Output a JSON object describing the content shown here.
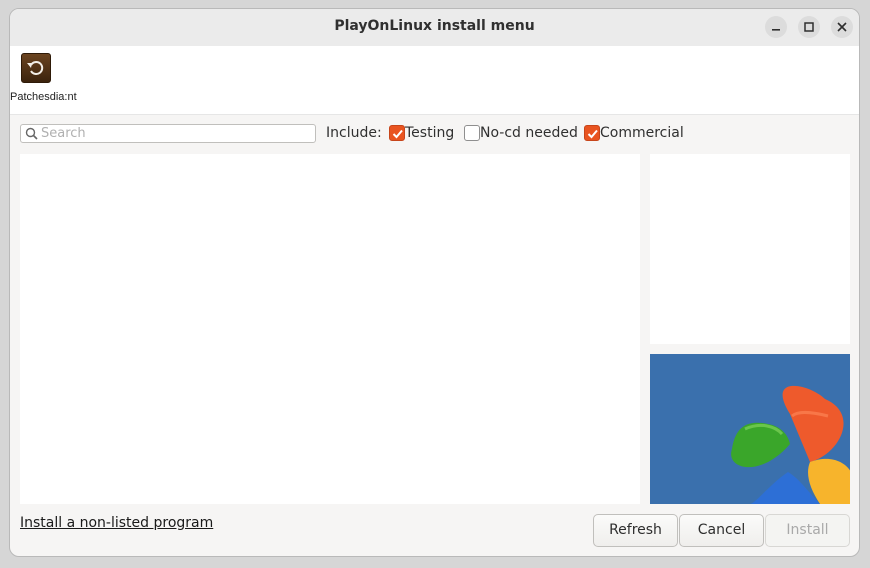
{
  "window": {
    "title": "PlayOnLinux install menu",
    "controls": [
      "minimize-icon",
      "maximize-icon",
      "close-icon"
    ]
  },
  "toolbar": {
    "items": [
      {
        "label": "Patchesdia:nt",
        "icon": "patches-icon"
      }
    ]
  },
  "filter": {
    "search_placeholder": "Search",
    "search_value": "",
    "include_label": "Include:",
    "options": [
      {
        "label": "Testing",
        "checked": true
      },
      {
        "label": "No-cd needed",
        "checked": false
      },
      {
        "label": "Commercial",
        "checked": true
      }
    ]
  },
  "footer": {
    "link_label": "Install a non-listed program",
    "buttons": {
      "refresh": "Refresh",
      "cancel": "Cancel",
      "install": "Install"
    }
  },
  "colors": {
    "accent": "#e95420",
    "logo_background": "#3a70ad"
  }
}
